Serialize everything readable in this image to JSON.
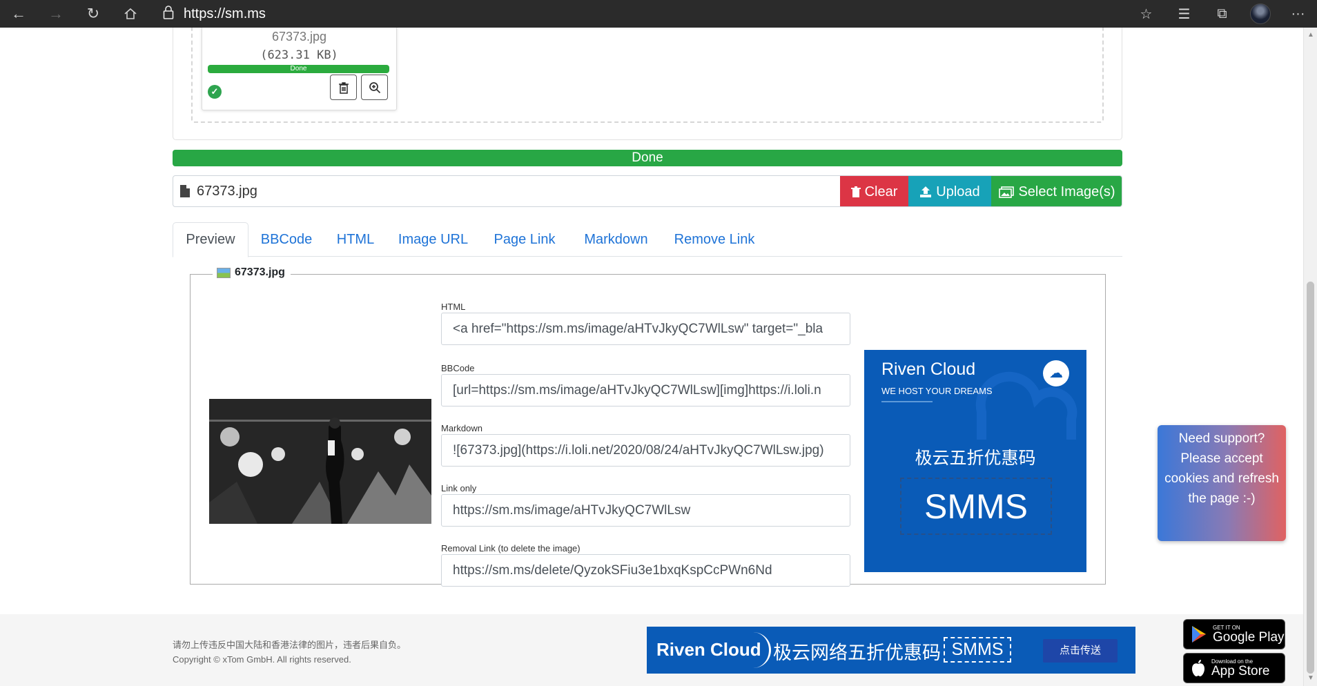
{
  "browser": {
    "url": "https://sm.ms",
    "back_icon": "arrow-left-icon",
    "forward_icon": "arrow-right-icon",
    "refresh_icon": "refresh-icon",
    "home_icon": "home-icon"
  },
  "upload_item": {
    "filename": "67373.jpg",
    "size": "(623.31 KB)",
    "status": "Done",
    "progress": 1.0
  },
  "done_bar": {
    "label": "Done",
    "progress": 1.0
  },
  "file_input": {
    "filename": "67373.jpg",
    "clear_label": "Clear",
    "upload_label": "Upload",
    "select_label": "Select Image(s)"
  },
  "tabs": [
    {
      "label": "Preview",
      "active": true
    },
    {
      "label": "BBCode",
      "active": false
    },
    {
      "label": "HTML",
      "active": false
    },
    {
      "label": "Image URL",
      "active": false
    },
    {
      "label": "Page Link",
      "active": false
    },
    {
      "label": "Markdown",
      "active": false
    },
    {
      "label": "Remove Link",
      "active": false
    }
  ],
  "preview": {
    "legend": "67373.jpg",
    "fields": [
      {
        "label": "HTML",
        "value": "<a href=\"https://sm.ms/image/aHTvJkyQC7WlLsw\" target=\"_bla"
      },
      {
        "label": "BBCode",
        "value": "[url=https://sm.ms/image/aHTvJkyQC7WlLsw][img]https://i.loli.n"
      },
      {
        "label": "Markdown",
        "value": "![67373.jpg](https://i.loli.net/2020/08/24/aHTvJkyQC7WlLsw.jpg)"
      },
      {
        "label": "Link only",
        "value": "https://sm.ms/image/aHTvJkyQC7WlLsw"
      },
      {
        "label": "Removal Link (to delete the image)",
        "value": "https://sm.ms/delete/QyzokSFiu3e1bxqKspCcPWn6Nd"
      }
    ]
  },
  "ad": {
    "brand": "Riven Cloud",
    "tagline": "WE HOST YOUR DREAMS",
    "promo": "极云五折优惠码",
    "code": "SMMS",
    "color": "#0a5bb7"
  },
  "support": {
    "text": "Need support? Please accept cookies and refresh the page :-)"
  },
  "footer": {
    "notice": "请勿上传违反中国大陆和香港法律的图片，违者后果自负。",
    "copyright": "Copyright © xTom GmbH. All rights reserved.",
    "banner": {
      "brand": "Riven Cloud",
      "text": "极云网络五折优惠码",
      "code": "SMMS",
      "button": "点击传送"
    },
    "google_play": {
      "small": "GET IT ON",
      "big": "Google Play"
    },
    "app_store": {
      "small": "Download on the",
      "big": "App Store"
    }
  },
  "colors": {
    "success": "#28a745",
    "danger": "#dc3545",
    "info": "#17a2b8",
    "link": "#1e73d7"
  }
}
